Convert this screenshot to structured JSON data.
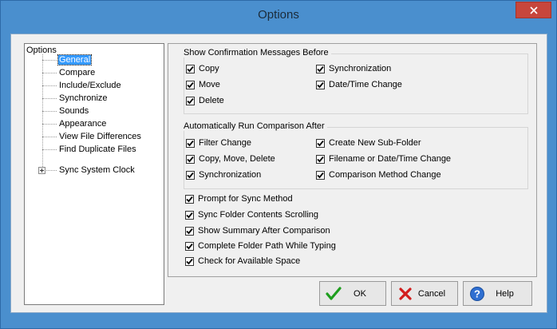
{
  "window": {
    "title": "Options",
    "close_icon": "close-icon"
  },
  "colors": {
    "frame": "#4a8fce",
    "close": "#c7463c",
    "selection": "#3399ff",
    "client": "#f0f0f0"
  },
  "tree": {
    "root": "Options",
    "items": [
      {
        "label": "General",
        "selected": true
      },
      {
        "label": "Compare"
      },
      {
        "label": "Include/Exclude"
      },
      {
        "label": "Synchronize"
      },
      {
        "label": "Sounds"
      },
      {
        "label": "Appearance"
      },
      {
        "label": "View File Differences"
      },
      {
        "label": "Find Duplicate Files"
      },
      {
        "label": "Sync System Clock",
        "expandable": true
      }
    ]
  },
  "confirm_group": {
    "label": "Show Confirmation Messages Before",
    "options": [
      {
        "label": "Copy",
        "checked": true
      },
      {
        "label": "Move",
        "checked": true
      },
      {
        "label": "Delete",
        "checked": true
      },
      {
        "label": "Synchronization",
        "checked": true
      },
      {
        "label": "Date/Time Change",
        "checked": true
      }
    ]
  },
  "auto_group": {
    "label": "Automatically Run Comparison After",
    "options": [
      {
        "label": "Filter Change",
        "checked": true
      },
      {
        "label": "Copy, Move, Delete",
        "checked": true
      },
      {
        "label": "Synchronization",
        "checked": true
      },
      {
        "label": "Create New Sub-Folder",
        "checked": true
      },
      {
        "label": "Filename or Date/Time Change",
        "checked": true
      },
      {
        "label": "Comparison Method Change",
        "checked": true
      }
    ]
  },
  "misc_options": [
    {
      "label": "Prompt for Sync Method",
      "checked": true
    },
    {
      "label": "Sync Folder Contents Scrolling",
      "checked": true
    },
    {
      "label": "Show Summary After Comparison",
      "checked": true
    },
    {
      "label": "Complete Folder Path While Typing",
      "checked": true
    },
    {
      "label": "Check for Available Space",
      "checked": true
    }
  ],
  "buttons": {
    "ok": {
      "label": "OK",
      "icon": "checkmark-icon"
    },
    "cancel": {
      "label": "Cancel",
      "icon": "red-x-icon"
    },
    "help": {
      "label": "Help",
      "icon": "help-icon"
    }
  }
}
